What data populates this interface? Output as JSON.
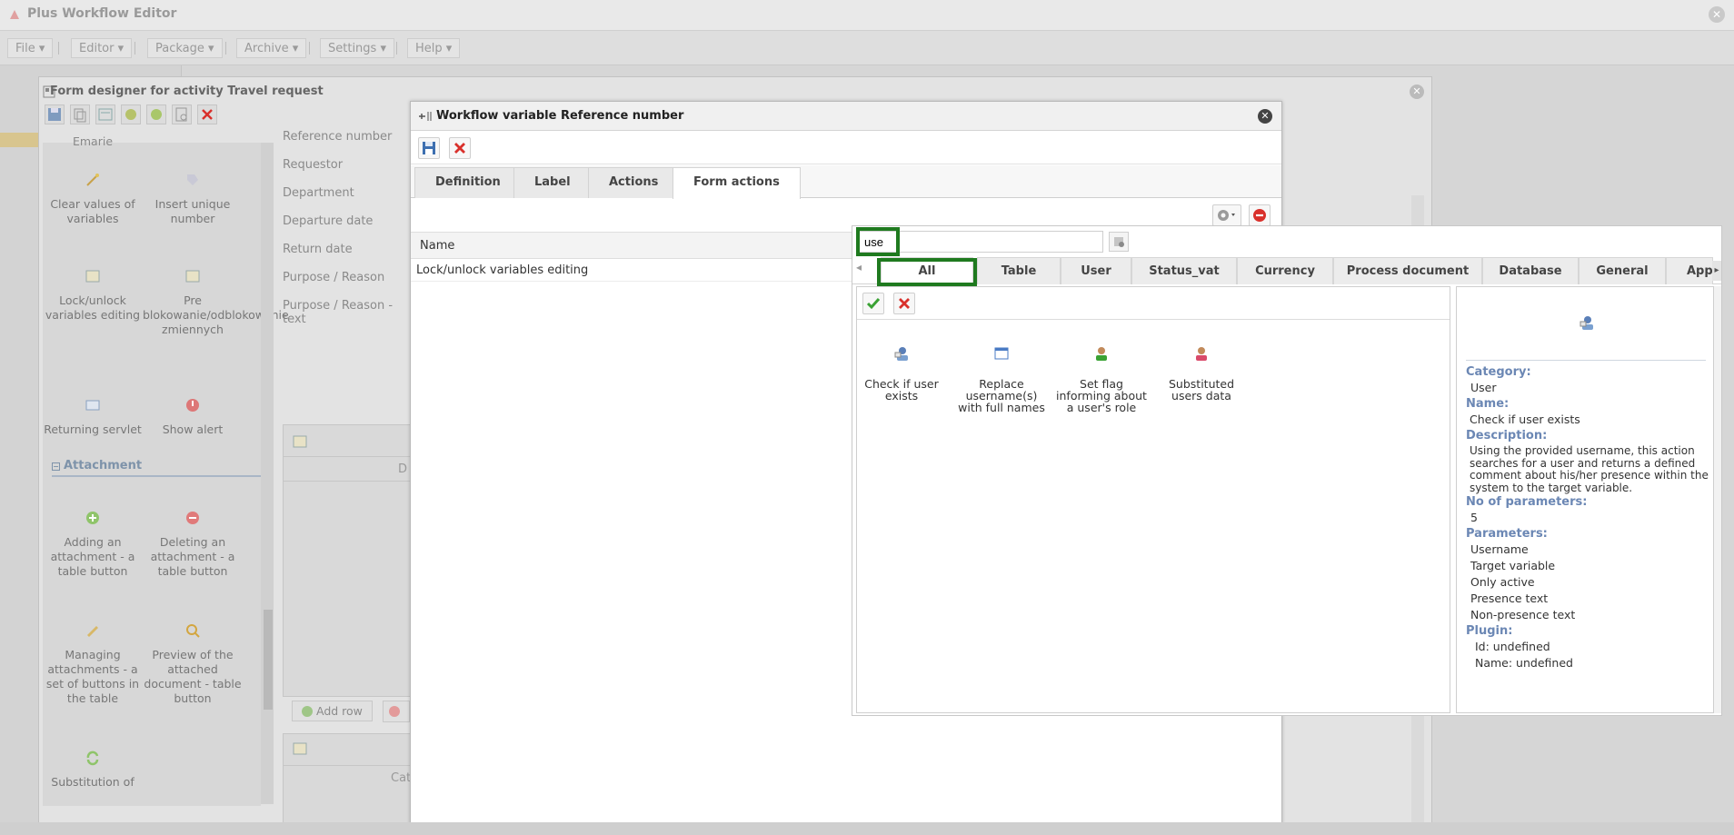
{
  "app": {
    "title": "Plus Workflow Editor"
  },
  "menubar": {
    "items": [
      "File",
      "Editor",
      "Package",
      "Archive",
      "Settings",
      "Help"
    ]
  },
  "designer": {
    "title": "Form designer for activity Travel request",
    "palette": {
      "truncated_top": "Emarie",
      "items": [
        "Clear values of variables",
        "Insert unique number",
        "Lock/unlock variables editing",
        "Pre blokowanie/odblokowanie zmiennych",
        "Returning servlet",
        "Show alert"
      ],
      "section": "Attachment",
      "attachment_items": [
        "Adding an attachment - a table button",
        "Deleting an attachment - a table button",
        "Managing attachments - a set of buttons in the table",
        "Preview of the attached document - table button",
        "Substitution of"
      ]
    },
    "fields": [
      "Reference number",
      "Requestor",
      "Department",
      "Departure date",
      "Return date",
      "Purpose / Reason",
      "Purpose / Reason - text"
    ],
    "grid1_col": "D",
    "grid2_col": "Cat",
    "add_row": "Add row"
  },
  "variable_window": {
    "title": "Workflow variable Reference number",
    "tabs": [
      "Definition",
      "Label",
      "Actions",
      "Form actions"
    ],
    "active_tab": "Form actions",
    "grid_header": "Name",
    "rows": [
      "Lock/unlock variables editing"
    ]
  },
  "chooser": {
    "search_value": "use",
    "categories": [
      "All",
      "Table",
      "User",
      "Status_vat",
      "Currency",
      "Process document",
      "Database",
      "General",
      "Appea"
    ],
    "active_category": "All",
    "actions": [
      {
        "label": "Check if user exists",
        "icon": "user-check-icon"
      },
      {
        "label": "Replace username(s) with full names",
        "icon": "window-icon"
      },
      {
        "label": "Set flag informing about a user's role",
        "icon": "user-green-icon"
      },
      {
        "label": "Substituted users data",
        "icon": "user-red-icon"
      }
    ],
    "details": {
      "category_label": "Category:",
      "category": "User",
      "name_label": "Name:",
      "name": "Check if user exists",
      "description_label": "Description:",
      "description": "Using the provided username, this action searches for a user and returns a defined comment about his/her presence within the system to the target variable.",
      "params_count_label": "No of parameters:",
      "params_count": "5",
      "params_label": "Parameters:",
      "params": [
        "Username",
        "Target variable",
        "Only active",
        "Presence text",
        "Non-presence text"
      ],
      "plugin_label": "Plugin:",
      "plugin_id": "Id: undefined",
      "plugin_name": "Name: undefined"
    }
  },
  "colors": {
    "accent_blue": "#6b87b4",
    "highlight_green": "#1f7a1f",
    "close_red": "#d9302b"
  }
}
